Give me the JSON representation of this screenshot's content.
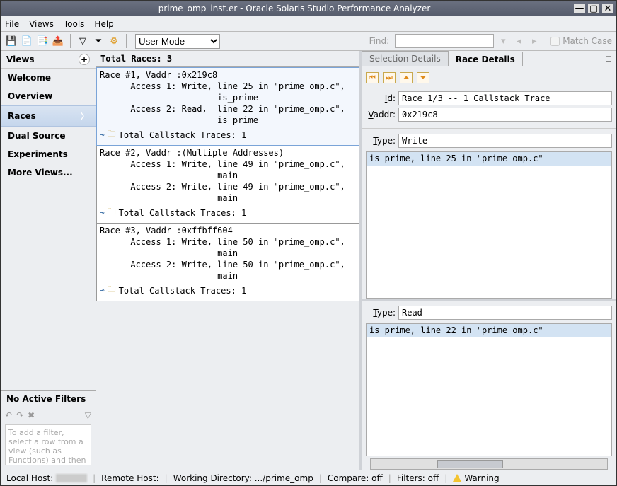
{
  "title": "prime_omp_inst.er  -  Oracle Solaris Studio Performance Analyzer",
  "menu": {
    "file": "File",
    "views": "Views",
    "tools": "Tools",
    "help": "Help"
  },
  "toolbar": {
    "mode": "User Mode",
    "find": "Find:",
    "match": "Match Case"
  },
  "sidebar": {
    "header": "Views",
    "items": [
      {
        "label": "Welcome"
      },
      {
        "label": "Overview"
      },
      {
        "label": "Races",
        "active": true
      },
      {
        "label": "Dual Source"
      },
      {
        "label": "Experiments"
      },
      {
        "label": "More Views..."
      }
    ],
    "filters_head": "No Active Filters",
    "filters_text": "To add a filter, select a row from a view (such as Functions) and then"
  },
  "center": {
    "header": "Total Races: 3",
    "races": [
      {
        "title": "Race #1, Vaddr :0x219c8",
        "a1": "      Access 1: Write, line 25 in \"prime_omp.c\",",
        "a1b": "                       is_prime",
        "a2": "      Access 2: Read,  line 22 in \"prime_omp.c\",",
        "a2b": "                       is_prime",
        "trace": "Total Callstack Traces: 1"
      },
      {
        "title": "Race #2, Vaddr :(Multiple Addresses)",
        "a1": "      Access 1: Write, line 49 in \"prime_omp.c\",",
        "a1b": "                       main",
        "a2": "      Access 2: Write, line 49 in \"prime_omp.c\",",
        "a2b": "                       main",
        "trace": "Total Callstack Traces: 1"
      },
      {
        "title": "Race #3, Vaddr :0xffbff604",
        "a1": "      Access 1: Write, line 50 in \"prime_omp.c\",",
        "a1b": "                       main",
        "a2": "      Access 2: Write, line 50 in \"prime_omp.c\",",
        "a2b": "                       main",
        "trace": "Total Callstack Traces: 1"
      }
    ]
  },
  "right": {
    "tab_sel": "Selection Details",
    "tab_race": "Race Details",
    "id_label": "Id:",
    "id_val": "Race 1/3 -- 1 Callstack Trace",
    "vaddr_label": "Vaddr:",
    "vaddr_val": "0x219c8",
    "type_label": "Type:",
    "type1": "Write",
    "stack1": "is_prime, line 25 in \"prime_omp.c\"",
    "type2": "Read",
    "stack2": "is_prime, line 22 in \"prime_omp.c\""
  },
  "status": {
    "local": "Local Host:",
    "remote": "Remote Host:",
    "wd": "Working Directory: .../prime_omp",
    "compare": "Compare: off",
    "filters": "Filters: off",
    "warning": "Warning"
  }
}
